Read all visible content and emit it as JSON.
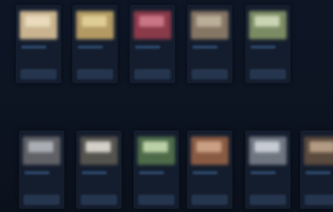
{
  "top_row": [
    {
      "label": "",
      "meta": "",
      "thumb_color": "#c9b48f",
      "hi_color": "#efe2c4"
    },
    {
      "label": "",
      "meta": "",
      "thumb_color": "#b39a62",
      "hi_color": "#e7d7a0"
    },
    {
      "label": "",
      "meta": "",
      "thumb_color": "#8a3a49",
      "hi_color": "#d58090"
    },
    {
      "label": "",
      "meta": "",
      "thumb_color": "#857664",
      "hi_color": "#c5b8a2"
    },
    {
      "label": "",
      "meta": "",
      "thumb_color": "#7b8b63",
      "hi_color": "#d8e1c1"
    }
  ],
  "bottom_row": [
    {
      "label": "",
      "meta": "",
      "thumb_color": "#5f6166",
      "hi_color": "#b8bcc2"
    },
    {
      "label": "",
      "meta": "",
      "thumb_color": "#55534e",
      "hi_color": "#e9e6de"
    },
    {
      "label": "",
      "meta": "",
      "thumb_color": "#4d6b49",
      "hi_color": "#cfe2b8"
    },
    {
      "label": "",
      "meta": "",
      "thumb_color": "#8a5b43",
      "hi_color": "#d5ad8f"
    },
    {
      "label": "",
      "meta": "",
      "thumb_color": "#6f7680",
      "hi_color": "#d6dbe2"
    },
    {
      "label": "",
      "meta": "",
      "thumb_color": "#5b4a3e",
      "hi_color": "#c2aa90"
    }
  ]
}
